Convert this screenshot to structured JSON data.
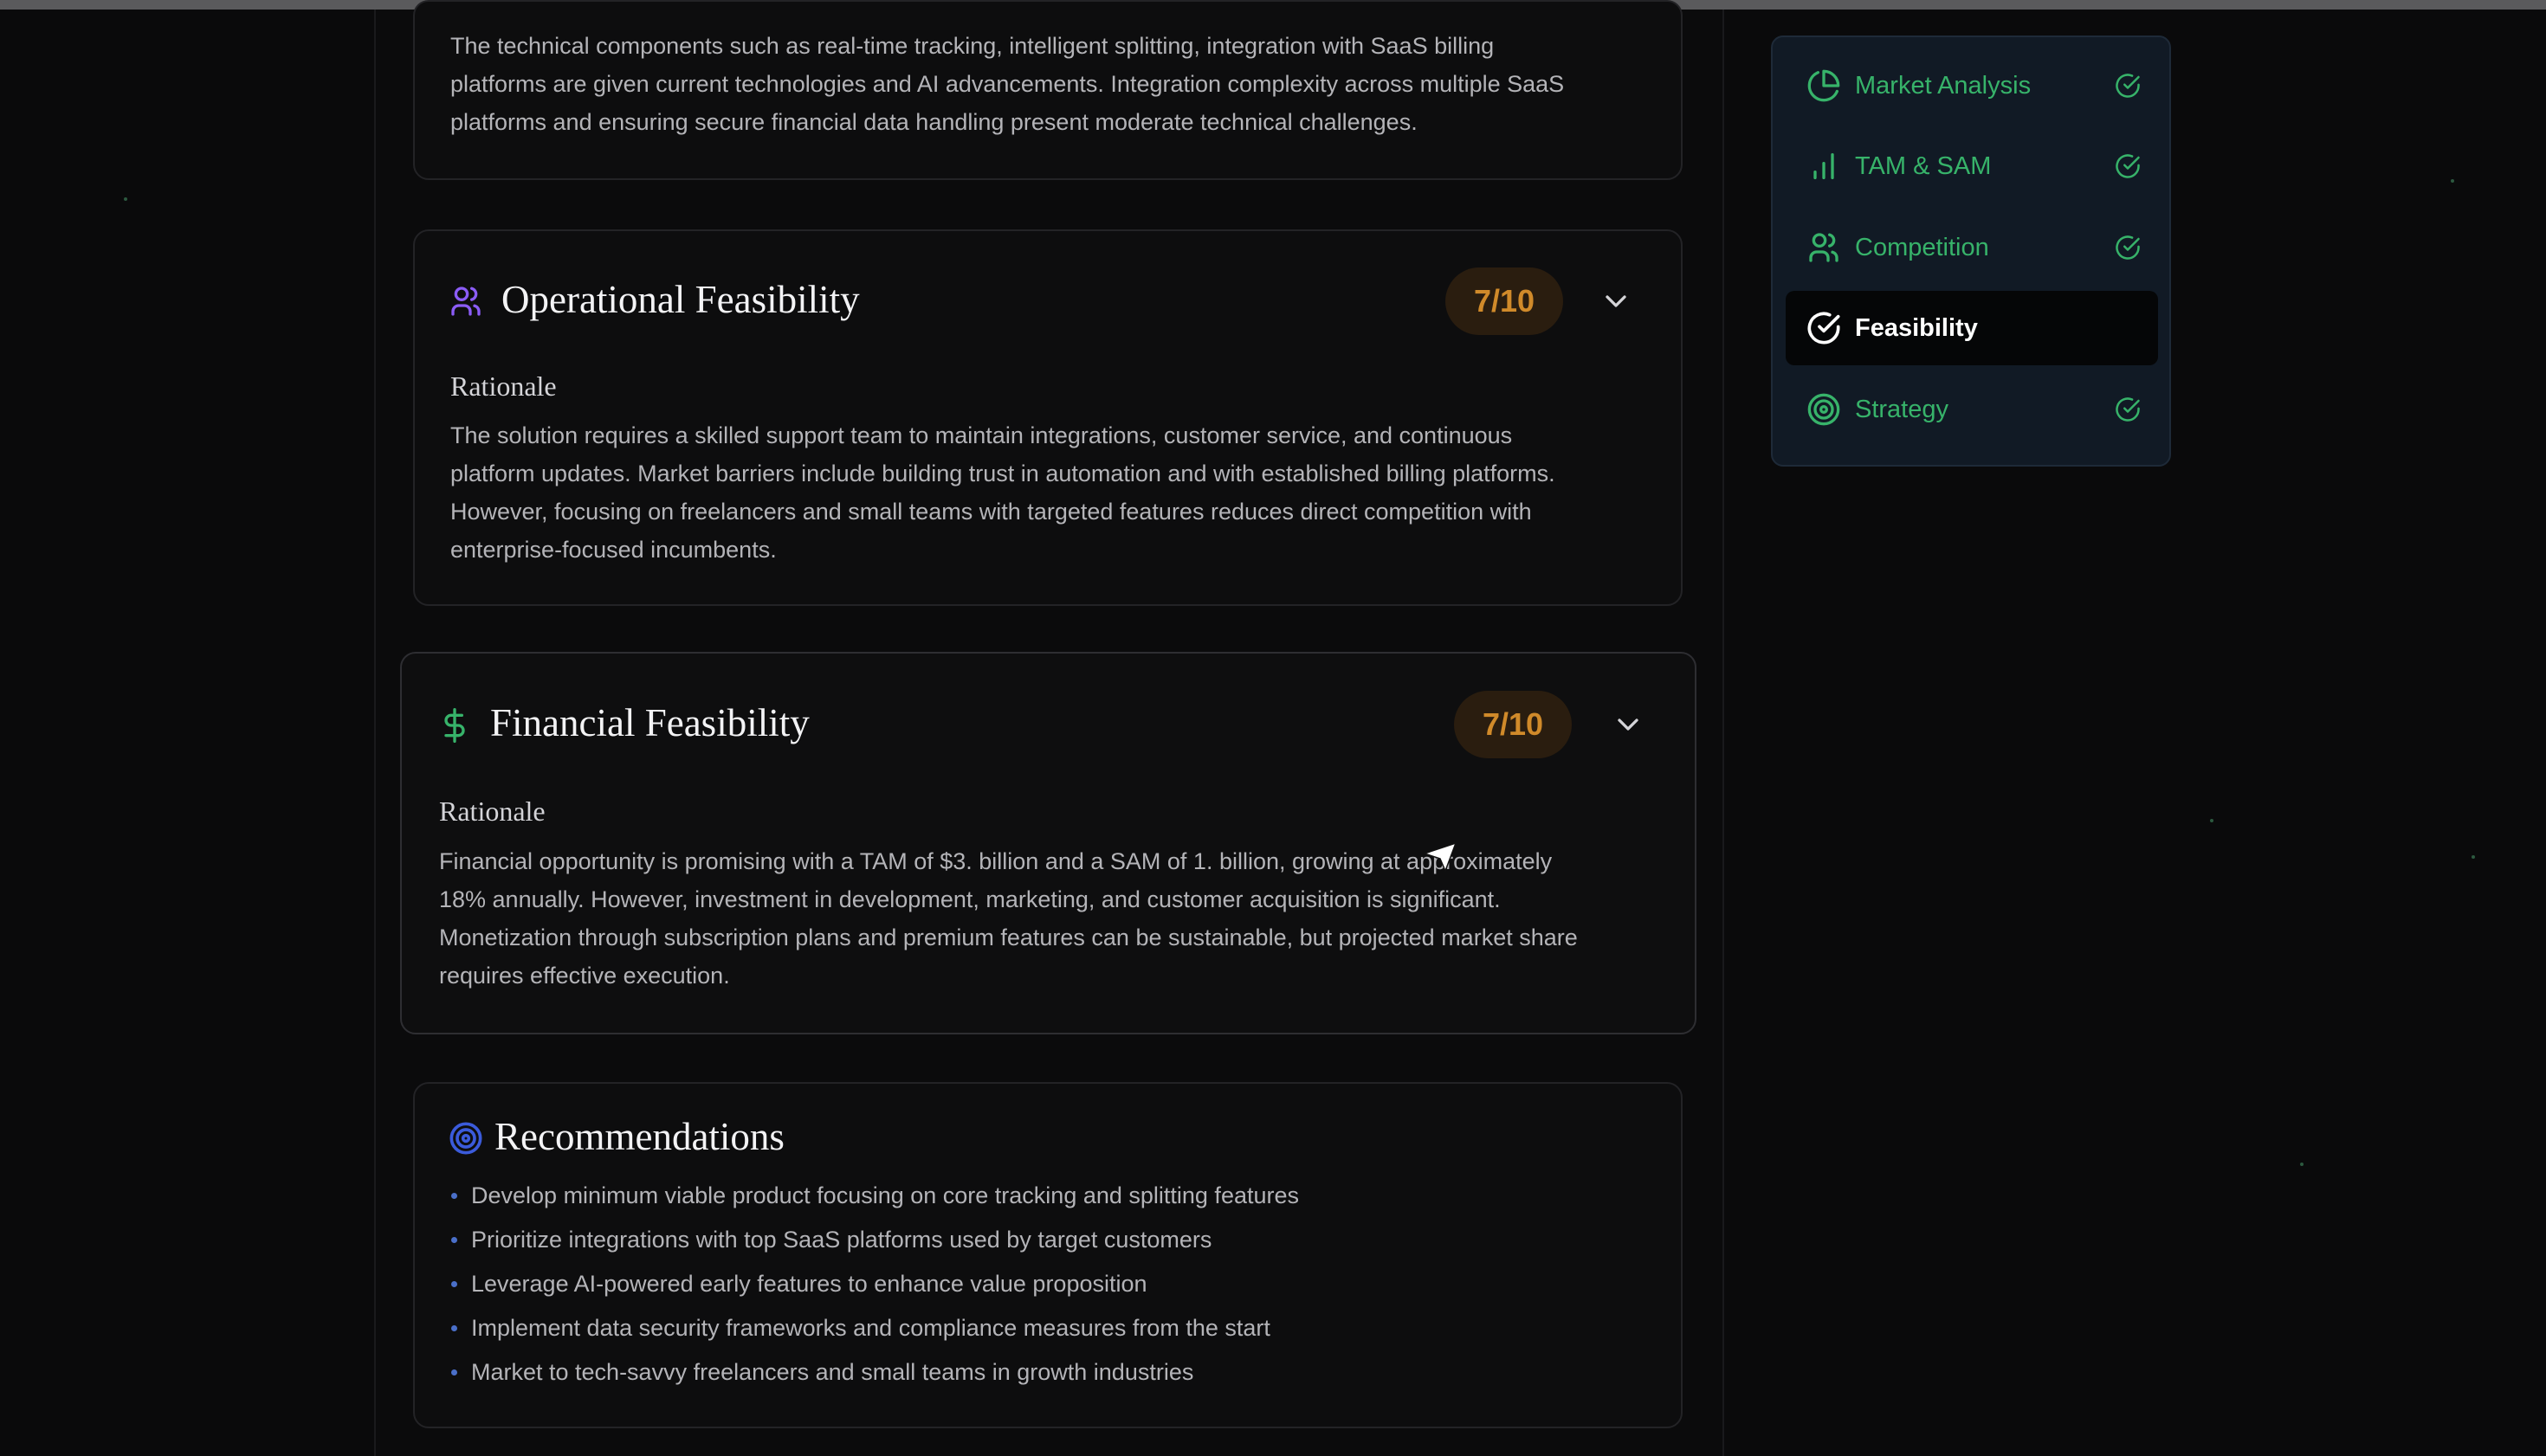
{
  "colors": {
    "background": "#0a0a0b",
    "accent_green": "#37b36a",
    "score_text": "#d08a2a",
    "score_bg": "#2a1d0f",
    "operational_icon": "#8b5cf6",
    "recommendations_icon": "#3b5bdb"
  },
  "technical": {
    "lines": [
      "The technical components such as real-time tracking, intelligent splitting, integration with SaaS billing",
      "platforms are given current technologies and AI advancements. Integration complexity across multiple SaaS",
      "platforms and ensuring secure financial data handling present moderate technical challenges."
    ]
  },
  "operational": {
    "icon": "users-icon",
    "title": "Operational Feasibility",
    "score": "7/10",
    "rationale_label": "Rationale",
    "lines": [
      "The solution requires a skilled support team to maintain integrations, customer service, and continuous",
      "platform updates. Market barriers include building trust in automation and with established billing platforms.",
      "However, focusing on freelancers and small teams with targeted features reduces direct competition with",
      "enterprise-focused incumbents."
    ]
  },
  "financial": {
    "icon": "dollar-icon",
    "title": "Financial Feasibility",
    "score": "7/10",
    "rationale_label": "Rationale",
    "lines": [
      "Financial opportunity is promising with a TAM of $3. billion and a SAM of 1. billion, growing at approximately",
      "18% annually. However, investment in development, marketing, and customer acquisition is significant.",
      "Monetization through subscription plans and premium features can be sustainable, but projected market share",
      "requires effective execution."
    ]
  },
  "recommendations": {
    "icon": "target-icon",
    "title": "Recommendations",
    "items": [
      "Develop minimum viable product focusing on core tracking and splitting features",
      "Prioritize integrations with top SaaS platforms used by target customers",
      "Leverage AI-powered early features to enhance value proposition",
      "Implement data security frameworks and compliance measures from the start",
      "Market to tech-savvy freelancers and small teams in growth industries"
    ]
  },
  "sidebar": {
    "items": [
      {
        "label": "Market Analysis",
        "icon": "pie-chart-icon",
        "status": "complete"
      },
      {
        "label": "TAM & SAM",
        "icon": "bar-chart-icon",
        "status": "complete"
      },
      {
        "label": "Competition",
        "icon": "users-icon",
        "status": "complete"
      },
      {
        "label": "Feasibility",
        "icon": "check-circle-icon",
        "status": "active"
      },
      {
        "label": "Strategy",
        "icon": "target-icon",
        "status": "complete"
      }
    ]
  }
}
